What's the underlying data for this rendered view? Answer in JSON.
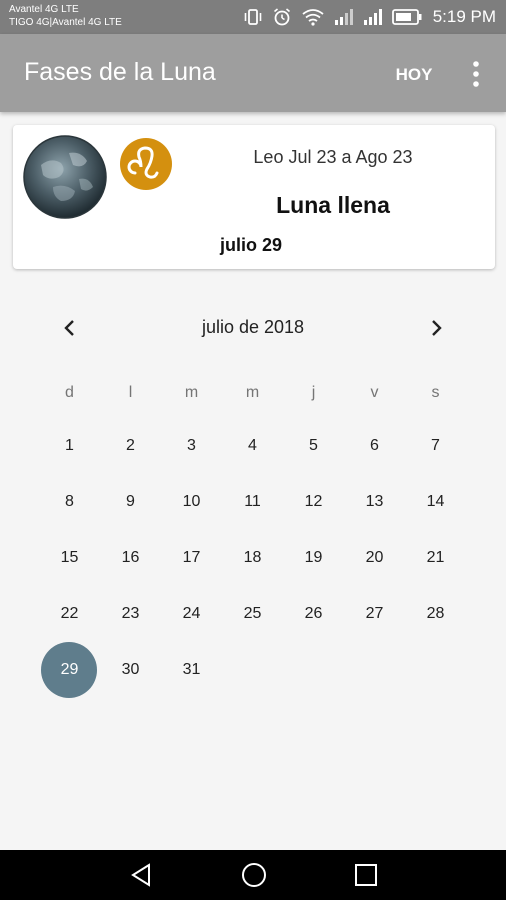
{
  "status_bar": {
    "carrier_line1": "Avantel 4G LTE",
    "carrier_line2": "TIGO 4G|Avantel 4G LTE",
    "time": "5:19 PM",
    "icons": [
      "vibrate-icon",
      "alarm-icon",
      "wifi-icon",
      "signal-icon",
      "signal-icon",
      "battery-icon"
    ]
  },
  "app_bar": {
    "title": "Fases de la Luna",
    "today_label": "HOY",
    "overflow_icon": "more-vert-icon"
  },
  "card": {
    "sign_range": "Leo Jul 23 a Ago 23",
    "phase_name": "Luna llena",
    "phase_date": "julio 29",
    "zodiac_icon": "leo-icon",
    "moon_icon": "full-moon-icon"
  },
  "calendar": {
    "month_title": "julio de 2018",
    "weekdays": [
      "d",
      "l",
      "m",
      "m",
      "j",
      "v",
      "s"
    ],
    "weeks": [
      [
        "1",
        "2",
        "3",
        "4",
        "5",
        "6",
        "7"
      ],
      [
        "8",
        "9",
        "10",
        "11",
        "12",
        "13",
        "14"
      ],
      [
        "15",
        "16",
        "17",
        "18",
        "19",
        "20",
        "21"
      ],
      [
        "22",
        "23",
        "24",
        "25",
        "26",
        "27",
        "28"
      ],
      [
        "29",
        "30",
        "31",
        "",
        "",
        "",
        ""
      ]
    ],
    "selected_day": "29",
    "selected_color": "#5f7d8c"
  },
  "colors": {
    "app_bar": "#9e9e9e",
    "status_bar": "#7e7e7e",
    "zodiac": "#d4900f"
  }
}
